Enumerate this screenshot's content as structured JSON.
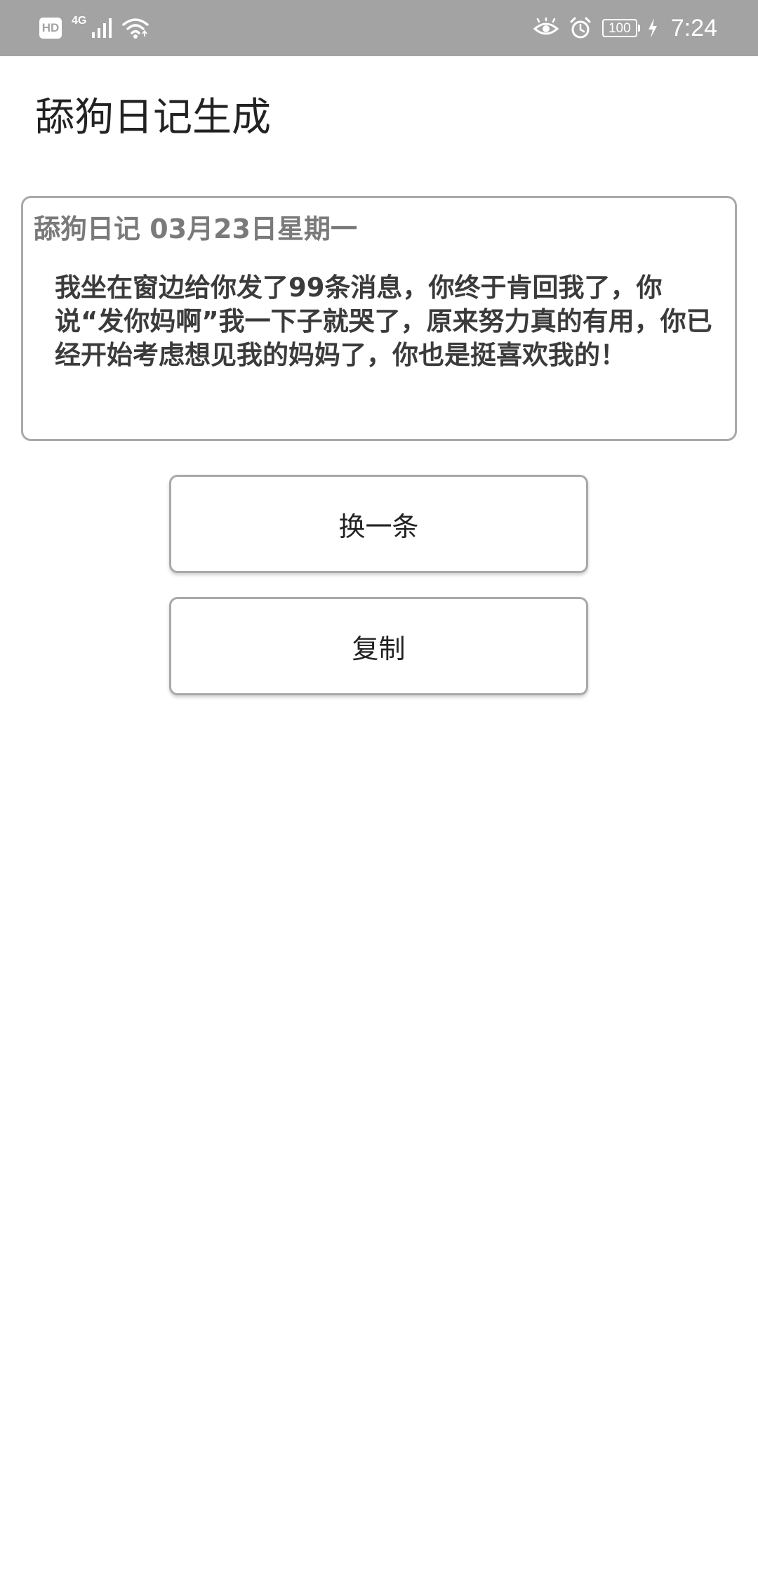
{
  "status_bar": {
    "hd_label": "HD",
    "network_type": "4G",
    "battery_level": "100",
    "time": "7:24"
  },
  "app": {
    "title": "舔狗日记生成"
  },
  "diary": {
    "header": "舔狗日记 03月23日星期一",
    "content": "我坐在窗边给你发了99条消息，你终于肯回我了，你说“发你妈啊”我一下子就哭了，原来努力真的有用，你已经开始考虑想见我的妈妈了，你也是挺喜欢我的！"
  },
  "buttons": {
    "next_label": "换一条",
    "copy_label": "复制"
  },
  "colors": {
    "status_bar_bg": "#a3a3a3",
    "card_border": "#a9a9a9",
    "header_text": "#7a7a7a",
    "body_text": "#3b3b3b"
  }
}
